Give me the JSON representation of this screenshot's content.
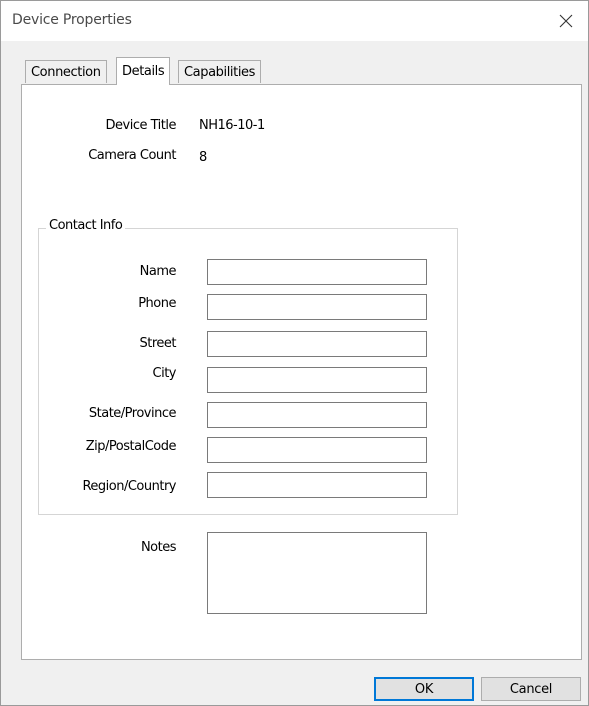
{
  "window": {
    "title": "Device Properties"
  },
  "tabs": [
    {
      "label": "Connection"
    },
    {
      "label": "Details"
    },
    {
      "label": "Capabilities"
    }
  ],
  "details": {
    "device_title_label": "Device Title",
    "device_title_value": "NH16-10-1",
    "camera_count_label": "Camera Count",
    "camera_count_value": "8"
  },
  "contact": {
    "group_title": "Contact Info",
    "fields": [
      {
        "label": "Name",
        "value": ""
      },
      {
        "label": "Phone",
        "value": ""
      },
      {
        "label": "Street",
        "value": ""
      },
      {
        "label": "City",
        "value": ""
      },
      {
        "label": "State/Province",
        "value": ""
      },
      {
        "label": "Zip/PostalCode",
        "value": ""
      },
      {
        "label": "Region/Country",
        "value": ""
      }
    ]
  },
  "notes": {
    "label": "Notes",
    "value": ""
  },
  "buttons": {
    "ok": "OK",
    "cancel": "Cancel"
  },
  "icons": {
    "close": "close-icon"
  }
}
